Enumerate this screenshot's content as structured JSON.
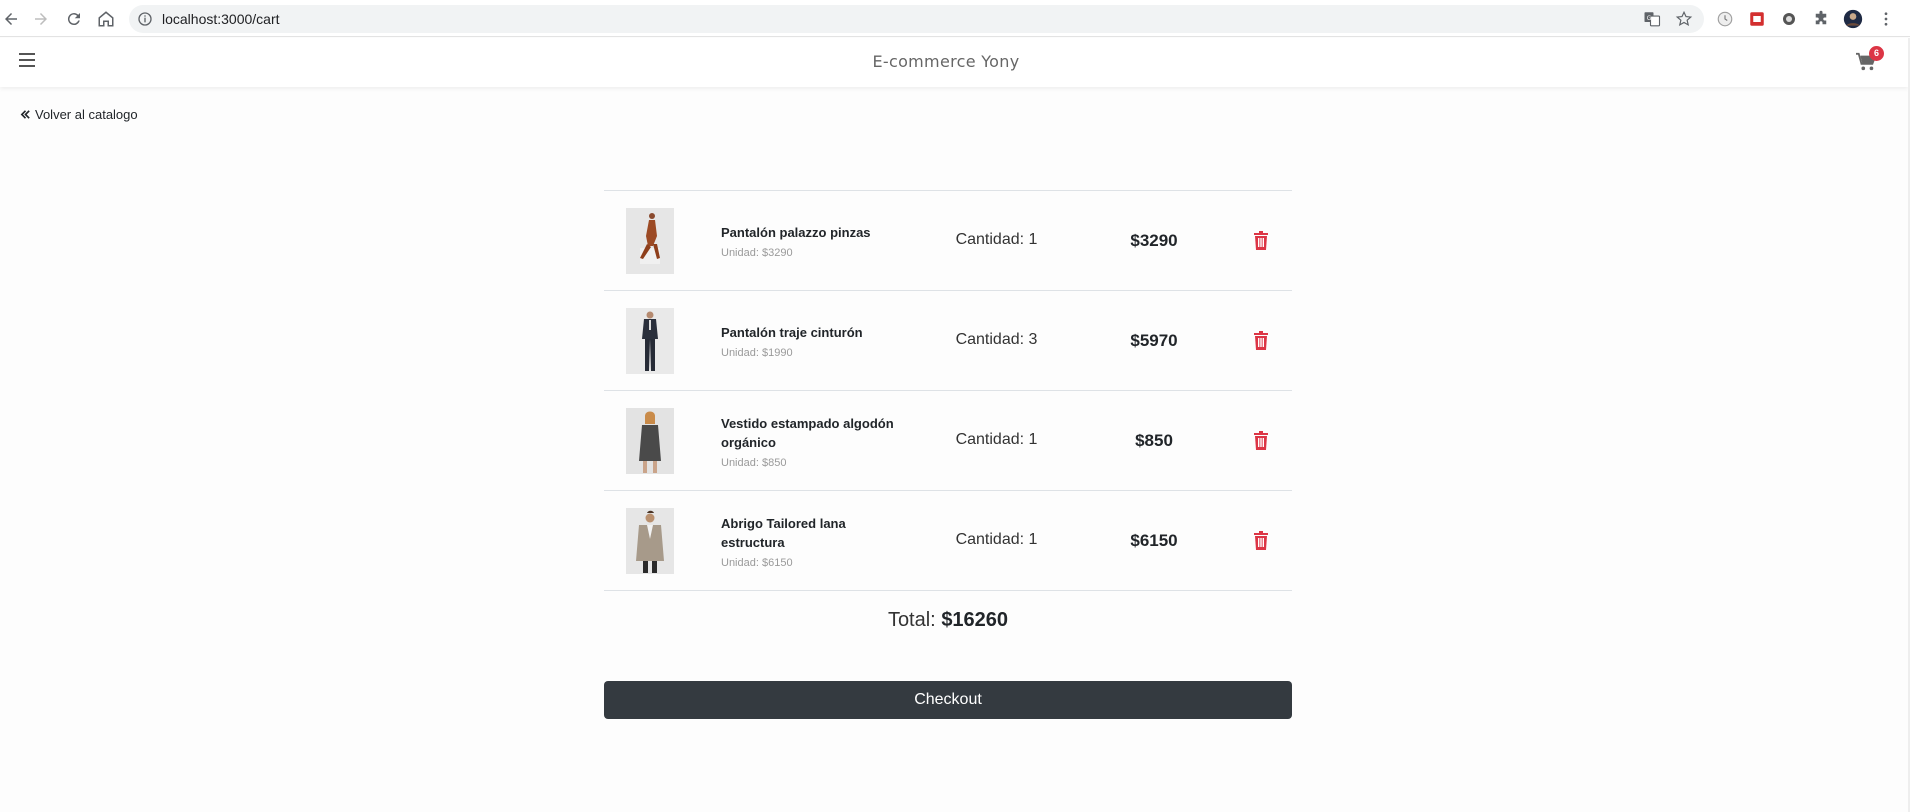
{
  "browser": {
    "url": "localhost:3000/cart"
  },
  "header": {
    "brand": "E-commerce Yony",
    "cart_count": "6"
  },
  "back_link": "Volver al catalogo",
  "cart": {
    "items": [
      {
        "name": "Pantalón palazzo pinzas",
        "unit": "Unidad: $3290",
        "qty": "Cantidad: 1",
        "price": "$3290"
      },
      {
        "name": "Pantalón traje cinturón",
        "unit": "Unidad: $1990",
        "qty": "Cantidad: 3",
        "price": "$5970"
      },
      {
        "name": "Vestido estampado algodón orgánico",
        "unit": "Unidad: $850",
        "qty": "Cantidad: 1",
        "price": "$850"
      },
      {
        "name": "Abrigo Tailored lana estructura",
        "unit": "Unidad: $6150",
        "qty": "Cantidad: 1",
        "price": "$6150"
      }
    ],
    "total_label": "Total:",
    "total_value": "$16260"
  },
  "checkout_label": "Checkout",
  "colors": {
    "accent_danger": "#dc3545",
    "button_dark": "#343a40"
  }
}
